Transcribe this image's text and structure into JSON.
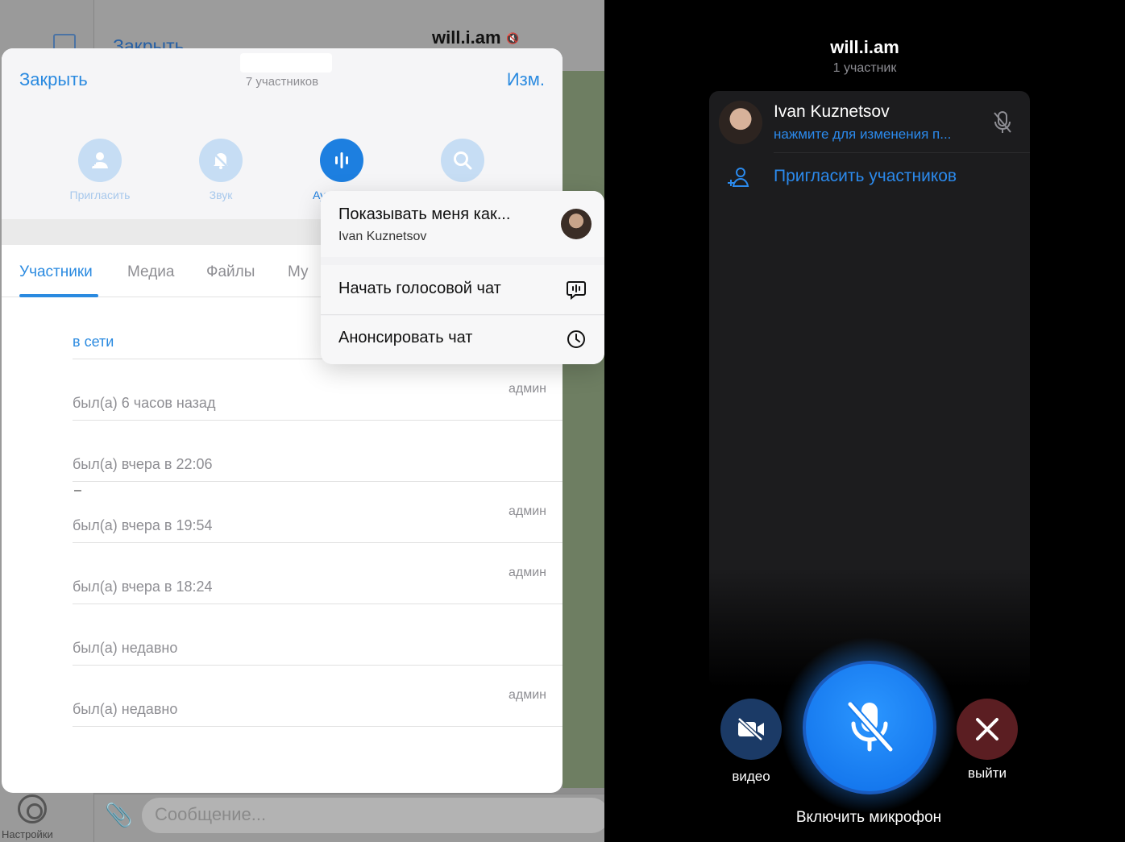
{
  "background": {
    "compose_label": "",
    "close_label": "Закрыть",
    "chat_title": "will.i.am",
    "message_placeholder": "Сообщение...",
    "settings_label": "Настройки"
  },
  "sheet": {
    "close": "Закрыть",
    "edit": "Изм.",
    "members_count": "7 участников",
    "actions": [
      {
        "label": "Пригласить",
        "icon": "add-user-icon"
      },
      {
        "label": "Звук",
        "icon": "bell-off-icon"
      },
      {
        "label": "Ау",
        "icon": "voice-chat-icon"
      },
      {
        "label": "",
        "icon": "search-icon"
      }
    ],
    "tabs": [
      "Участники",
      "Медиа",
      "Файлы",
      "Му"
    ],
    "members": [
      {
        "status": "в сети",
        "role": "",
        "online": true
      },
      {
        "status": "был(а) 6 часов назад",
        "role": "админ"
      },
      {
        "status": "был(а) вчера в 22:06",
        "role": ""
      },
      {
        "status": "был(а) вчера в 19:54",
        "role": "админ",
        "prefix": "–"
      },
      {
        "status": "был(а) вчера в 18:24",
        "role": "админ"
      },
      {
        "status": "был(а) недавно",
        "role": ""
      },
      {
        "status": "был(а) недавно",
        "role": "админ"
      }
    ]
  },
  "menu": {
    "show_as_title": "Показывать меня как...",
    "show_as_name": "Ivan Kuznetsov",
    "start_voice_chat": "Начать голосовой чат",
    "announce_chat": "Анонсировать чат"
  },
  "voice_chat": {
    "title": "will.i.am",
    "subtitle": "1 участник",
    "participant_name": "Ivan Kuznetsov",
    "participant_hint": "нажмите для изменения п...",
    "invite": "Пригласить участников",
    "video_label": "видео",
    "leave_label": "выйти",
    "mic_label": "Включить микрофон"
  },
  "colors": {
    "accent": "#2a8ae0",
    "voice_accent": "#2b8aed",
    "mic_button": "#1d7fe0",
    "leave_button": "#5b1e22",
    "video_button": "#1b3a66"
  }
}
